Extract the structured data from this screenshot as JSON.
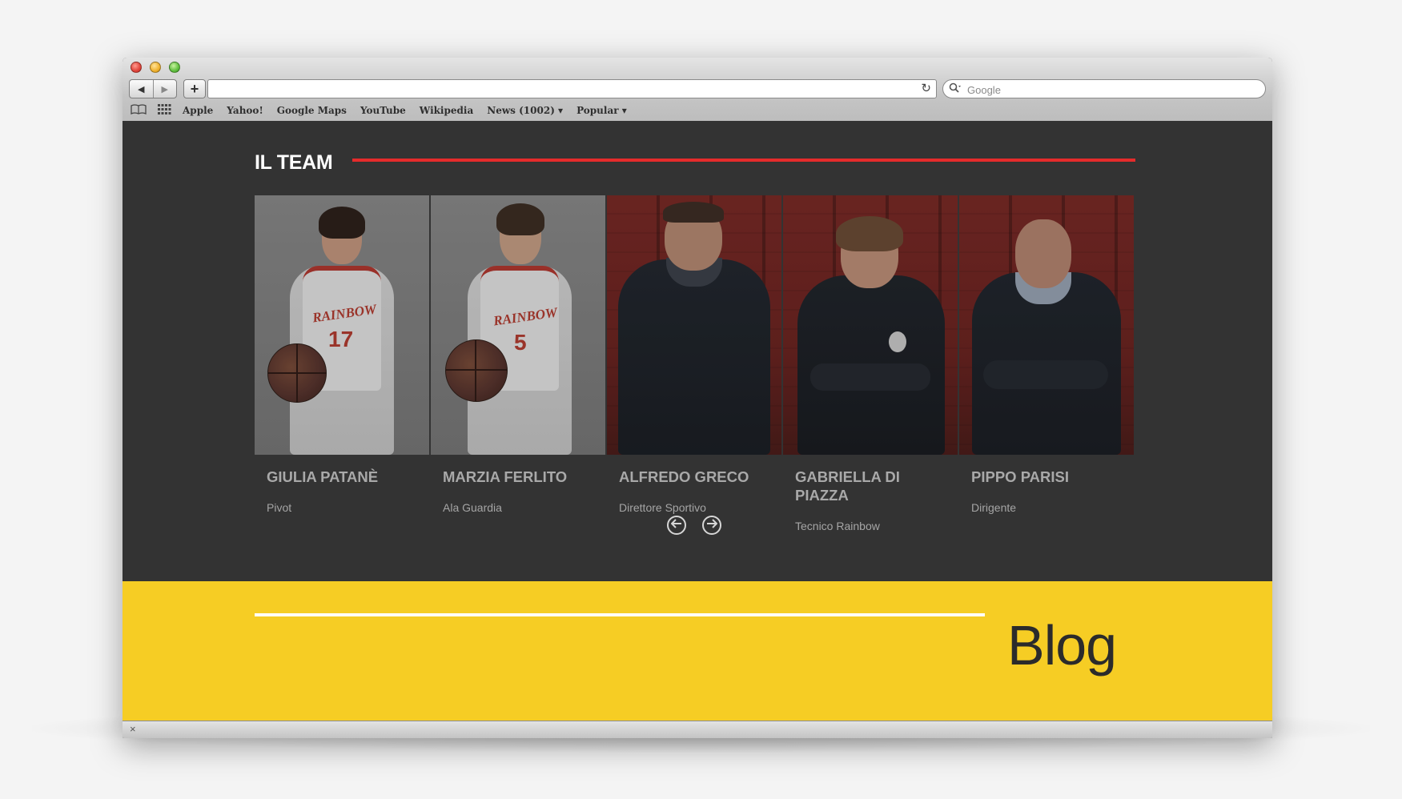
{
  "browser": {
    "nav": {
      "back_icon": "back-arrow-icon",
      "forward_icon": "forward-arrow-icon",
      "add_label": "+"
    },
    "address": {
      "value": "",
      "reload_icon": "reload-icon"
    },
    "search": {
      "placeholder": "Google",
      "icon": "search-icon"
    },
    "bookmarks": {
      "icons": [
        "book-icon",
        "grid-icon"
      ],
      "items": [
        {
          "label": "Apple"
        },
        {
          "label": "Yahoo!"
        },
        {
          "label": "Google Maps"
        },
        {
          "label": "YouTube"
        },
        {
          "label": "Wikipedia"
        },
        {
          "label": "News (1002) ▾"
        },
        {
          "label": "Popular ▾"
        }
      ]
    },
    "status_close": "×"
  },
  "team": {
    "title": "IL TEAM",
    "accent_color": "#e52b2b",
    "members": [
      {
        "name": "GIULIA PATANÈ",
        "role": "Pivot",
        "jersey": "17"
      },
      {
        "name": "MARZIA FERLITO",
        "role": "Ala Guardia",
        "jersey": "5"
      },
      {
        "name": "ALFREDO GRECO",
        "role": "Direttore Sportivo"
      },
      {
        "name": "GABRIELLA DI PIAZZA",
        "role": "Tecnico Rainbow"
      },
      {
        "name": "PIPPO PARISI",
        "role": "Dirigente"
      }
    ],
    "prev_icon": "arrow-left-circle-icon",
    "next_icon": "arrow-right-circle-icon"
  },
  "blog": {
    "title": "Blog",
    "band_color": "#f6cd24"
  }
}
